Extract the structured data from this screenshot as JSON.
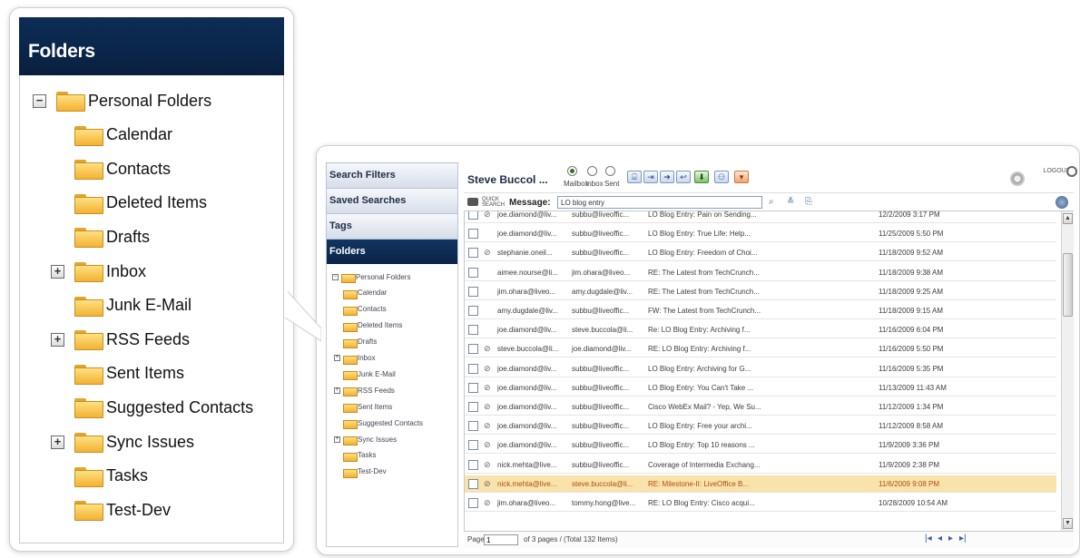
{
  "zoom": {
    "header_title": "Folders",
    "tree": [
      {
        "label": "Personal Folders",
        "level": 0,
        "expander": "-"
      },
      {
        "label": "Calendar",
        "level": 1
      },
      {
        "label": "Contacts",
        "level": 1
      },
      {
        "label": "Deleted Items",
        "level": 1
      },
      {
        "label": "Drafts",
        "level": 1
      },
      {
        "label": "Inbox",
        "level": 1,
        "expander": "+"
      },
      {
        "label": "Junk E-Mail",
        "level": 1
      },
      {
        "label": "RSS Feeds",
        "level": 1,
        "expander": "+"
      },
      {
        "label": "Sent Items",
        "level": 1
      },
      {
        "label": "Suggested Contacts",
        "level": 1
      },
      {
        "label": "Sync Issues",
        "level": 1,
        "expander": "+"
      },
      {
        "label": "Tasks",
        "level": 1
      },
      {
        "label": "Test-Dev",
        "level": 1
      }
    ]
  },
  "app": {
    "nav": {
      "search_filters": "Search Filters",
      "saved_searches": "Saved Searches",
      "tags": "Tags",
      "folders": "Folders"
    },
    "user_name": "Steve Buccol ...",
    "radios": {
      "mailbox": "Mailbox",
      "inbox": "Inbox",
      "sent": "Sent"
    },
    "logout": "LOGOUT",
    "quick_search_line1": "QUICK",
    "quick_search_line2": "SEARCH",
    "message_label": "Message:",
    "message_value": "LO blog entry",
    "rows": [
      {
        "from": "joe.diamond@liv...",
        "to": "subbu@liveoffic...",
        "subject": "LO Blog Entry: Pain on Sending...",
        "date": "12/2/2009 3:17 PM",
        "attach": true
      },
      {
        "from": "joe.diamond@liv...",
        "to": "subbu@liveoffic...",
        "subject": "LO Blog Entry: True Life: Help...",
        "date": "11/25/2009 5:50 PM",
        "attach": false
      },
      {
        "from": "stephanie.oneil...",
        "to": "subbu@liveoffic...",
        "subject": "LO Blog Entry: Freedom of Choi...",
        "date": "11/18/2009 9:52 AM",
        "attach": true
      },
      {
        "from": "aimee.nourse@li...",
        "to": "jim.ohara@liveo...",
        "subject": "RE: The Latest from TechCrunch...",
        "date": "11/18/2009 9:38 AM",
        "attach": false
      },
      {
        "from": "jim.ohara@liveo...",
        "to": "amy.dugdale@liv...",
        "subject": "RE: The Latest from TechCrunch...",
        "date": "11/18/2009 9:25 AM",
        "attach": false
      },
      {
        "from": "amy.dugdale@liv...",
        "to": "subbu@liveoffic...",
        "subject": "FW: The Latest from TechCrunch...",
        "date": "11/18/2009 9:15 AM",
        "attach": false
      },
      {
        "from": "joe.diamond@liv...",
        "to": "steve.buccola@li...",
        "subject": "Re: LO Blog Entry: Archiving f...",
        "date": "11/16/2009 6:04 PM",
        "attach": false
      },
      {
        "from": "steve.buccola@li...",
        "to": "joe.diamond@liv...",
        "subject": "RE: LO Blog Entry: Archiving f...",
        "date": "11/16/2009 5:50 PM",
        "attach": true
      },
      {
        "from": "joe.diamond@liv...",
        "to": "subbu@liveoffic...",
        "subject": "LO Blog Entry: Archiving for G...",
        "date": "11/16/2009 5:35 PM",
        "attach": true
      },
      {
        "from": "joe.diamond@liv...",
        "to": "subbu@liveoffic...",
        "subject": "LO Blog Entry: You Can't Take ...",
        "date": "11/13/2009 11:43 AM",
        "attach": true
      },
      {
        "from": "joe.diamond@liv...",
        "to": "subbu@liveoffic...",
        "subject": "Cisco WebEx Mail? - Yep, We Su...",
        "date": "11/12/2009 1:34 PM",
        "attach": true
      },
      {
        "from": "joe.diamond@liv...",
        "to": "subbu@liveoffic...",
        "subject": "LO Blog Entry: Free your archi...",
        "date": "11/12/2009 8:58 AM",
        "attach": true
      },
      {
        "from": "joe.diamond@liv...",
        "to": "subbu@liveoffic...",
        "subject": "LO Blog Entry: Top 10 reasons ...",
        "date": "11/9/2009 3:36 PM",
        "attach": true
      },
      {
        "from": "nick.mehta@live...",
        "to": "subbu@liveoffic...",
        "subject": "Coverage of Intermedia Exchang...",
        "date": "11/9/2009 2:38 PM",
        "attach": true
      },
      {
        "from": "nick.mehta@live...",
        "to": "steve.buccola@li...",
        "subject": "RE: Milestone-II: LiveOffice B...",
        "date": "11/6/2009 9:08 PM",
        "attach": true,
        "selected": true
      },
      {
        "from": "jim.ohara@liveo...",
        "to": "tommy.hong@live...",
        "subject": "RE: LO Blog Entry: Cisco acqui...",
        "date": "10/28/2009 10:54 AM",
        "attach": true
      }
    ],
    "pager": {
      "page_label": "Page",
      "page_value": "1",
      "summary": "of 3 pages / (Total 132 Items)"
    }
  }
}
